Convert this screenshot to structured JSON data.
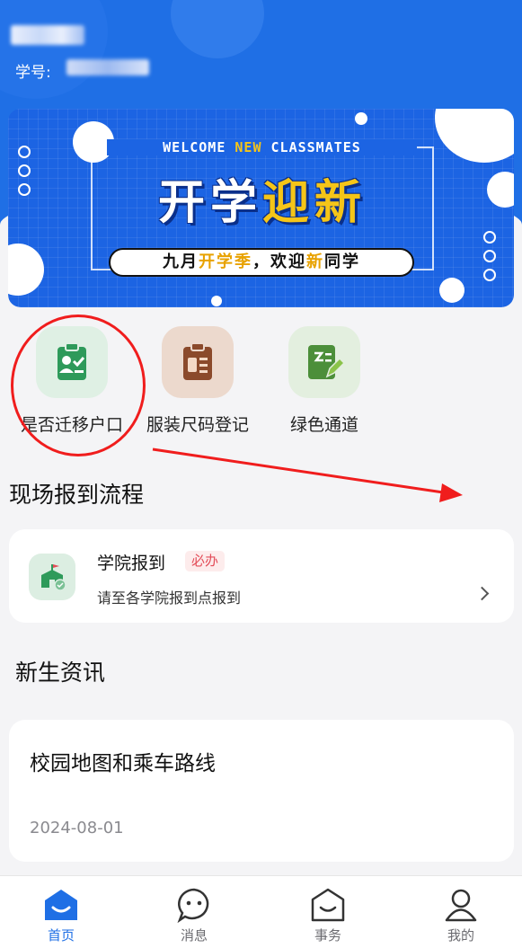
{
  "header": {
    "student_id_label": "学号:"
  },
  "banner": {
    "top_words": [
      "WELCOME ",
      "NEW",
      " CLASSMATES"
    ],
    "main_words": [
      "开学",
      "迎新"
    ],
    "pill_words": [
      "九月",
      "开学季",
      "，欢迎",
      "新",
      "同学"
    ]
  },
  "quick_entries": [
    {
      "label": "是否迁移户口",
      "icon": "id-card-check-icon",
      "bg": "#dff0e4",
      "fg": "#2e9a5a"
    },
    {
      "label": "服装尺码登记",
      "icon": "clipboard-icon",
      "bg": "#ecd9cd",
      "fg": "#8b4a2b"
    },
    {
      "label": "绿色通道",
      "icon": "pen-note-icon",
      "bg": "#e3efdf",
      "fg": "#4c8f3a"
    }
  ],
  "process": {
    "title": "现场报到流程",
    "item": {
      "title": "学院报到",
      "tag": "必办",
      "subtitle": "请至各学院报到点报到",
      "icon": "school-building-icon"
    }
  },
  "news": {
    "title": "新生资讯",
    "items": [
      {
        "title": "校园地图和乘车路线",
        "date": "2024-08-01"
      }
    ]
  },
  "tabbar": [
    {
      "label": "首页",
      "icon": "home-smile-icon",
      "active": true
    },
    {
      "label": "消息",
      "icon": "message-bubble-icon",
      "active": false
    },
    {
      "label": "事务",
      "icon": "house-smile-icon",
      "active": false
    },
    {
      "label": "我的",
      "icon": "user-icon",
      "active": false
    }
  ],
  "colors": {
    "primary": "#1f6fe5",
    "tag_red": "#e34d59",
    "annotation_red": "#f01d1d"
  }
}
